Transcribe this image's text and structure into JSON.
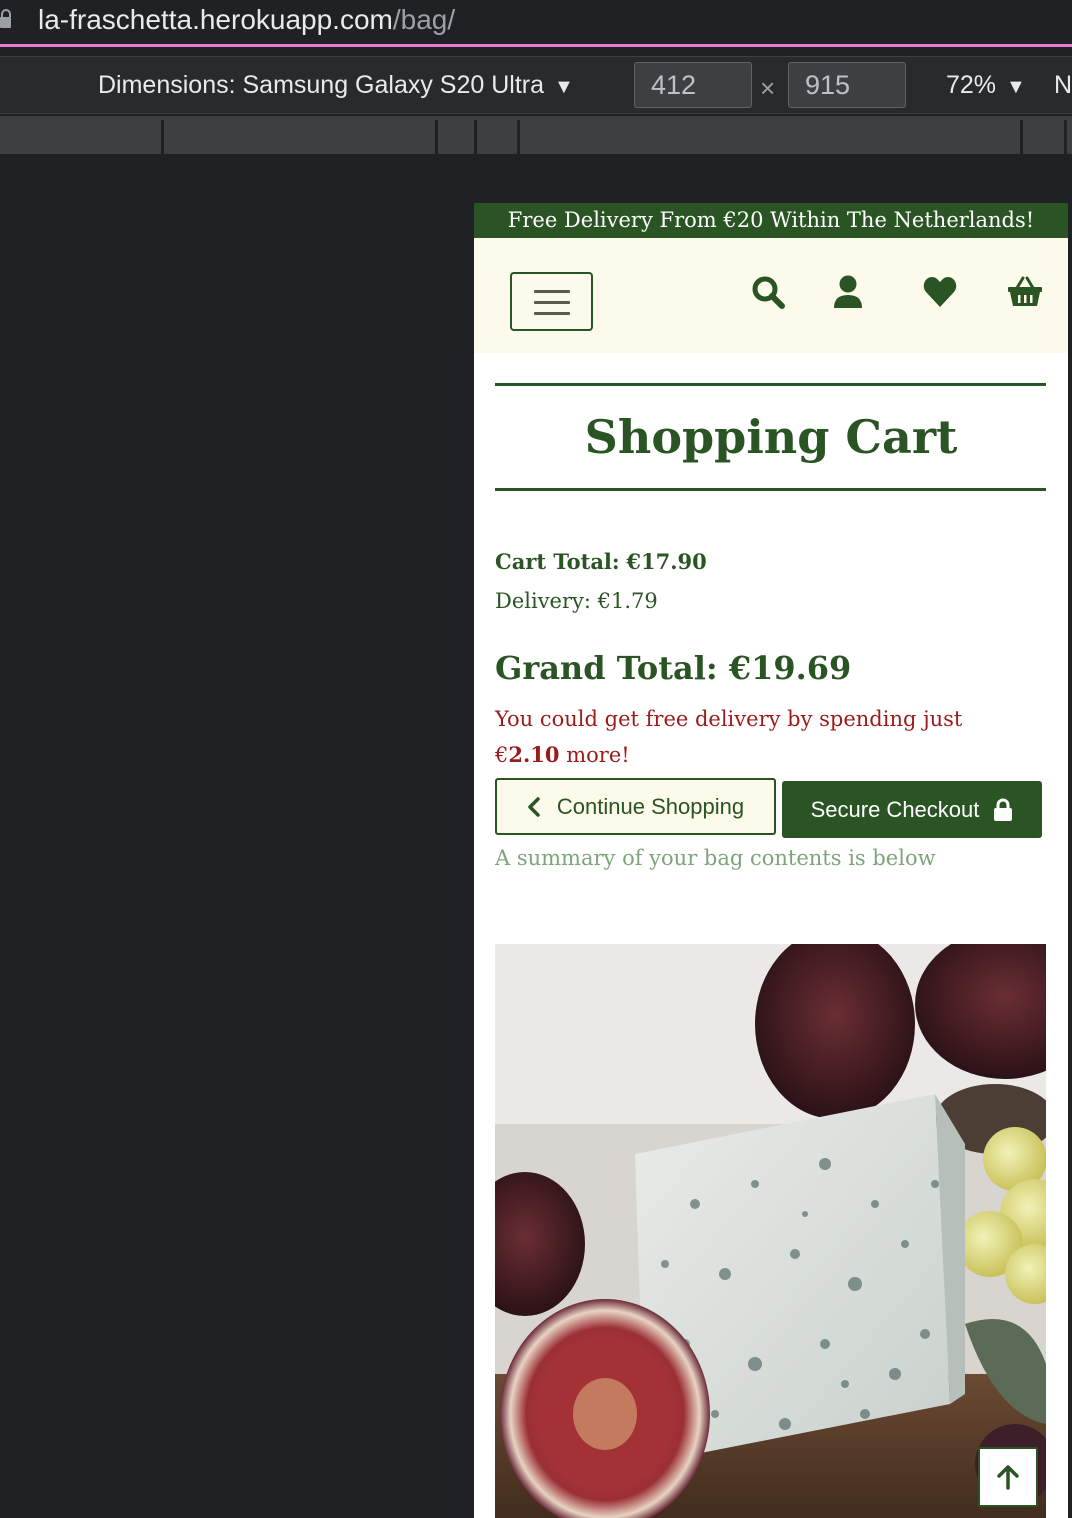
{
  "browser": {
    "url_host": "la-fraschetta.herokuapp.com",
    "url_path": "/bag/"
  },
  "devtools": {
    "dimensions_label": "Dimensions: Samsung Galaxy S20 Ultra",
    "width_value": "412",
    "height_value": "915",
    "times_symbol": "×",
    "zoom_label": "72%",
    "more_label": "N"
  },
  "site": {
    "promo_banner": "Free Delivery From €20 Within The Netherlands!",
    "nav_icons": [
      "search-icon",
      "account-icon",
      "heart-icon",
      "basket-icon"
    ],
    "colors": {
      "brand_green": "#2b5424",
      "nav_background": "#fcfaea",
      "warning_red": "#9b1b1b",
      "muted_green": "#7ea47a"
    }
  },
  "cart": {
    "title": "Shopping Cart",
    "cart_total_label": "Cart Total:",
    "cart_total_value": "€17.90",
    "delivery_label": "Delivery:",
    "delivery_value": "€1.79",
    "grand_total_label": "Grand Total:",
    "grand_total_value": "€19.69",
    "free_delivery_prefix": "You could get free delivery by spending just",
    "free_delivery_amount_symbol": "€",
    "free_delivery_amount": "2.10",
    "free_delivery_suffix": "more!",
    "continue_label": "Continue Shopping",
    "checkout_label": "Secure Checkout",
    "bag_note": "A summary of your bag contents is below"
  }
}
